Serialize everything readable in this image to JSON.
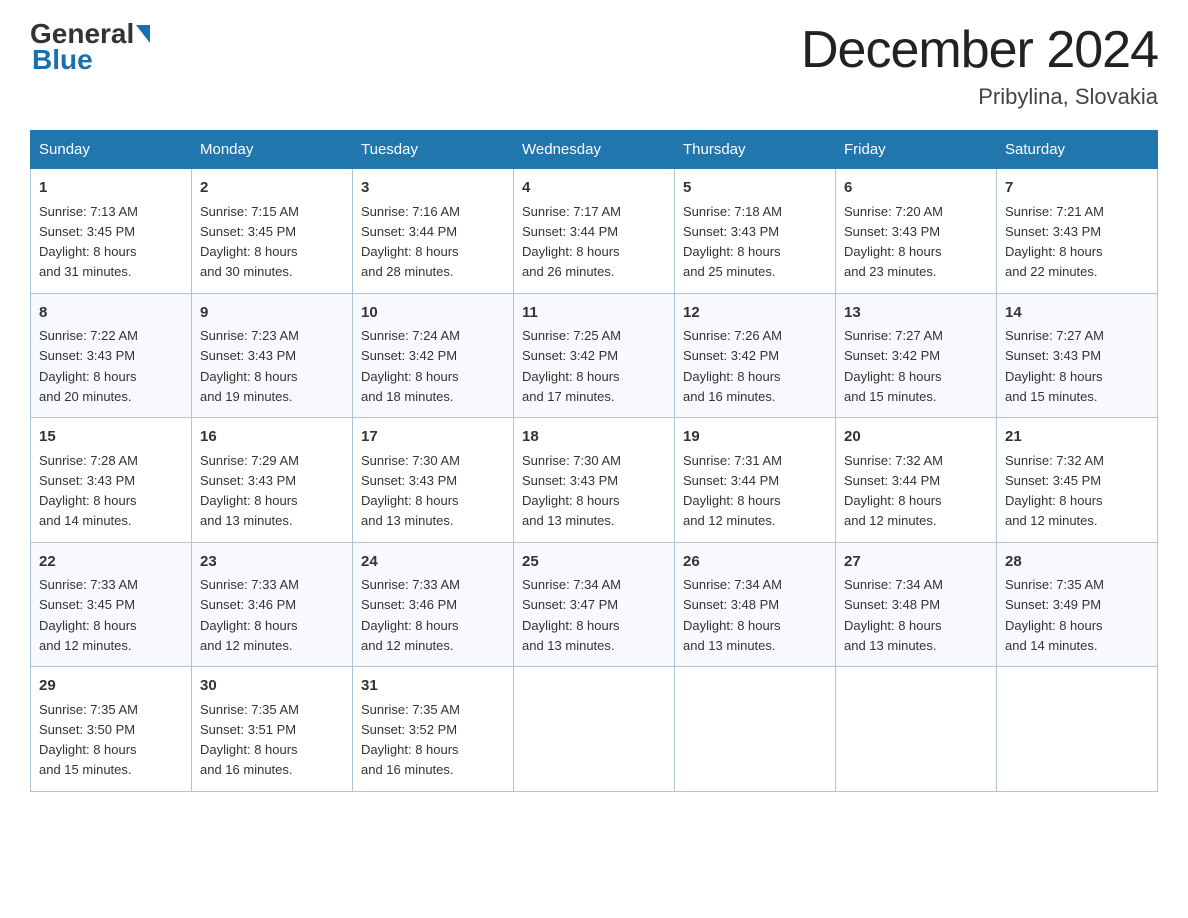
{
  "header": {
    "logo_line1": "General",
    "logo_line2": "Blue",
    "month": "December 2024",
    "location": "Pribylina, Slovakia"
  },
  "days_of_week": [
    "Sunday",
    "Monday",
    "Tuesday",
    "Wednesday",
    "Thursday",
    "Friday",
    "Saturday"
  ],
  "weeks": [
    [
      {
        "day": "1",
        "sunrise": "7:13 AM",
        "sunset": "3:45 PM",
        "daylight": "8 hours and 31 minutes."
      },
      {
        "day": "2",
        "sunrise": "7:15 AM",
        "sunset": "3:45 PM",
        "daylight": "8 hours and 30 minutes."
      },
      {
        "day": "3",
        "sunrise": "7:16 AM",
        "sunset": "3:44 PM",
        "daylight": "8 hours and 28 minutes."
      },
      {
        "day": "4",
        "sunrise": "7:17 AM",
        "sunset": "3:44 PM",
        "daylight": "8 hours and 26 minutes."
      },
      {
        "day": "5",
        "sunrise": "7:18 AM",
        "sunset": "3:43 PM",
        "daylight": "8 hours and 25 minutes."
      },
      {
        "day": "6",
        "sunrise": "7:20 AM",
        "sunset": "3:43 PM",
        "daylight": "8 hours and 23 minutes."
      },
      {
        "day": "7",
        "sunrise": "7:21 AM",
        "sunset": "3:43 PM",
        "daylight": "8 hours and 22 minutes."
      }
    ],
    [
      {
        "day": "8",
        "sunrise": "7:22 AM",
        "sunset": "3:43 PM",
        "daylight": "8 hours and 20 minutes."
      },
      {
        "day": "9",
        "sunrise": "7:23 AM",
        "sunset": "3:43 PM",
        "daylight": "8 hours and 19 minutes."
      },
      {
        "day": "10",
        "sunrise": "7:24 AM",
        "sunset": "3:42 PM",
        "daylight": "8 hours and 18 minutes."
      },
      {
        "day": "11",
        "sunrise": "7:25 AM",
        "sunset": "3:42 PM",
        "daylight": "8 hours and 17 minutes."
      },
      {
        "day": "12",
        "sunrise": "7:26 AM",
        "sunset": "3:42 PM",
        "daylight": "8 hours and 16 minutes."
      },
      {
        "day": "13",
        "sunrise": "7:27 AM",
        "sunset": "3:42 PM",
        "daylight": "8 hours and 15 minutes."
      },
      {
        "day": "14",
        "sunrise": "7:27 AM",
        "sunset": "3:43 PM",
        "daylight": "8 hours and 15 minutes."
      }
    ],
    [
      {
        "day": "15",
        "sunrise": "7:28 AM",
        "sunset": "3:43 PM",
        "daylight": "8 hours and 14 minutes."
      },
      {
        "day": "16",
        "sunrise": "7:29 AM",
        "sunset": "3:43 PM",
        "daylight": "8 hours and 13 minutes."
      },
      {
        "day": "17",
        "sunrise": "7:30 AM",
        "sunset": "3:43 PM",
        "daylight": "8 hours and 13 minutes."
      },
      {
        "day": "18",
        "sunrise": "7:30 AM",
        "sunset": "3:43 PM",
        "daylight": "8 hours and 13 minutes."
      },
      {
        "day": "19",
        "sunrise": "7:31 AM",
        "sunset": "3:44 PM",
        "daylight": "8 hours and 12 minutes."
      },
      {
        "day": "20",
        "sunrise": "7:32 AM",
        "sunset": "3:44 PM",
        "daylight": "8 hours and 12 minutes."
      },
      {
        "day": "21",
        "sunrise": "7:32 AM",
        "sunset": "3:45 PM",
        "daylight": "8 hours and 12 minutes."
      }
    ],
    [
      {
        "day": "22",
        "sunrise": "7:33 AM",
        "sunset": "3:45 PM",
        "daylight": "8 hours and 12 minutes."
      },
      {
        "day": "23",
        "sunrise": "7:33 AM",
        "sunset": "3:46 PM",
        "daylight": "8 hours and 12 minutes."
      },
      {
        "day": "24",
        "sunrise": "7:33 AM",
        "sunset": "3:46 PM",
        "daylight": "8 hours and 12 minutes."
      },
      {
        "day": "25",
        "sunrise": "7:34 AM",
        "sunset": "3:47 PM",
        "daylight": "8 hours and 13 minutes."
      },
      {
        "day": "26",
        "sunrise": "7:34 AM",
        "sunset": "3:48 PM",
        "daylight": "8 hours and 13 minutes."
      },
      {
        "day": "27",
        "sunrise": "7:34 AM",
        "sunset": "3:48 PM",
        "daylight": "8 hours and 13 minutes."
      },
      {
        "day": "28",
        "sunrise": "7:35 AM",
        "sunset": "3:49 PM",
        "daylight": "8 hours and 14 minutes."
      }
    ],
    [
      {
        "day": "29",
        "sunrise": "7:35 AM",
        "sunset": "3:50 PM",
        "daylight": "8 hours and 15 minutes."
      },
      {
        "day": "30",
        "sunrise": "7:35 AM",
        "sunset": "3:51 PM",
        "daylight": "8 hours and 16 minutes."
      },
      {
        "day": "31",
        "sunrise": "7:35 AM",
        "sunset": "3:52 PM",
        "daylight": "8 hours and 16 minutes."
      },
      null,
      null,
      null,
      null
    ]
  ],
  "labels": {
    "sunrise": "Sunrise:",
    "sunset": "Sunset:",
    "daylight": "Daylight:"
  }
}
